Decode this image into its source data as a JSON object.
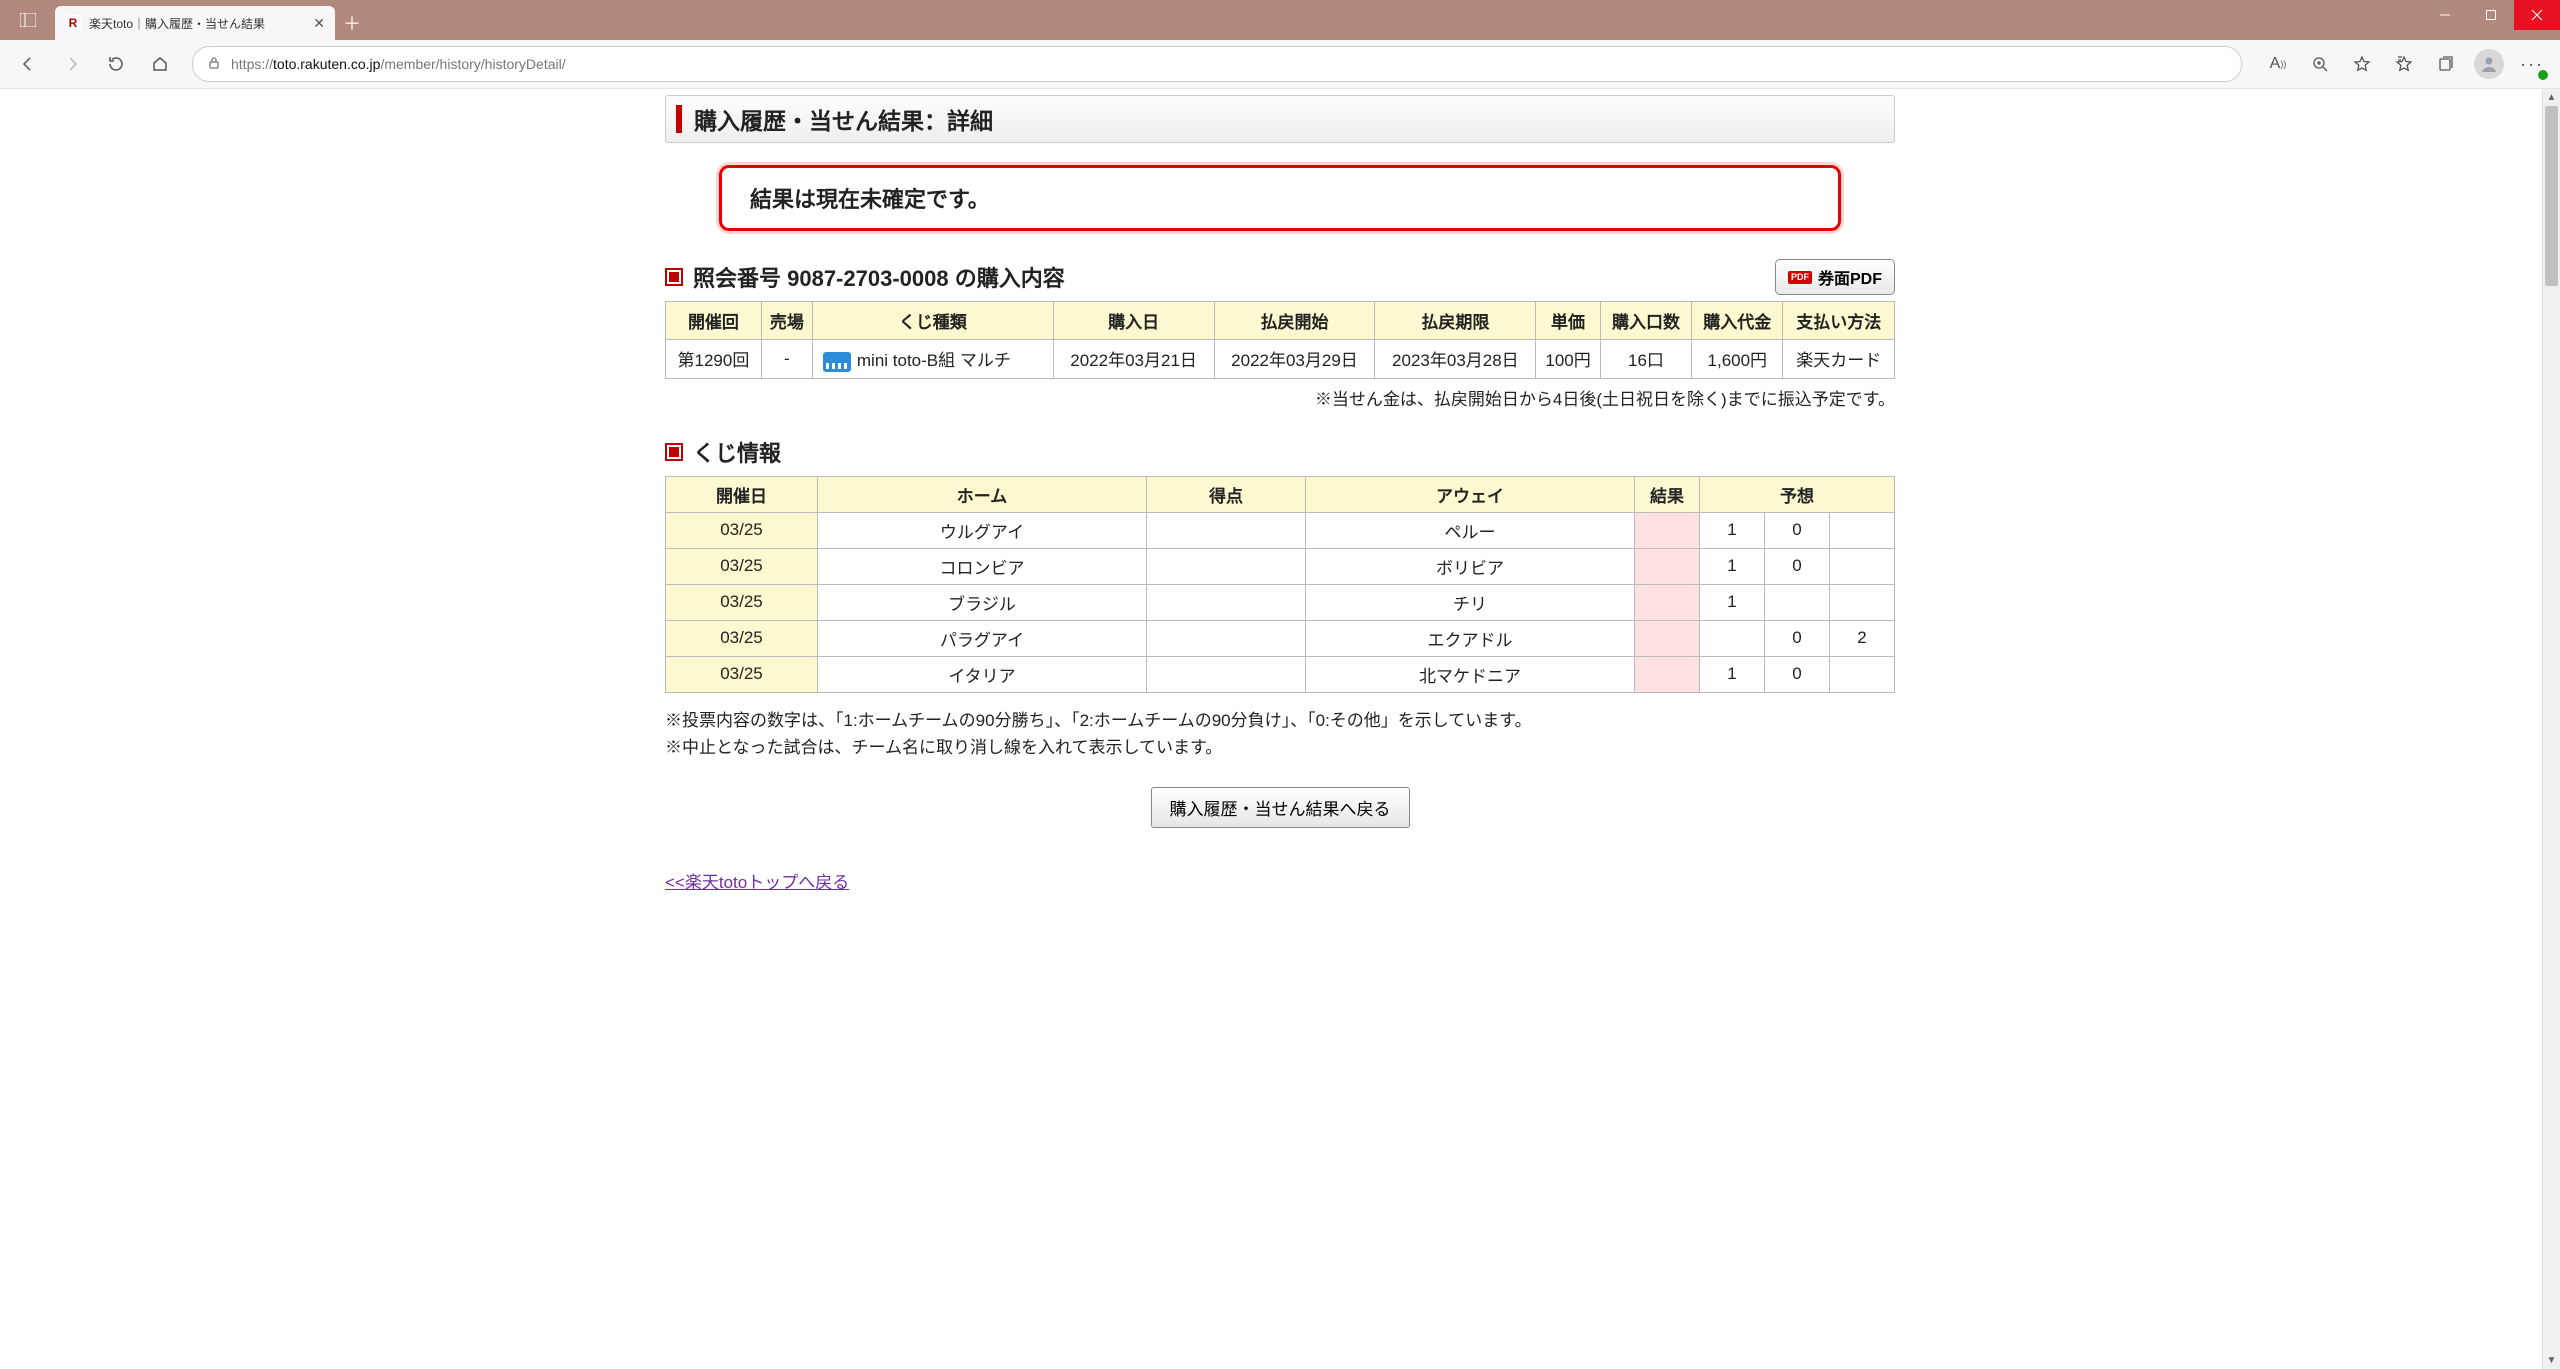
{
  "browser": {
    "tab_title": "楽天toto｜購入履歴・当せん結果",
    "url_prefix": "https://",
    "url_domain": "toto.rakuten.co.jp",
    "url_path": "/member/history/historyDetail/",
    "favicon_letter": "R"
  },
  "page": {
    "header": "購入履歴・当せん結果：詳細",
    "notice": "結果は現在未確定です。",
    "section_purchase": "照会番号 9087-2703-0008 の購入内容",
    "pdf_label": "券面PDF",
    "pdf_icon_text": "PDF",
    "purchase_headers": [
      "開催回",
      "売場",
      "くじ種類",
      "購入日",
      "払戻開始",
      "払戻期限",
      "単価",
      "購入口数",
      "購入代金",
      "支払い方法"
    ],
    "purchase_row": {
      "kaiji": "第1290回",
      "uriba": "-",
      "kuji": "mini toto-B組 マルチ",
      "buy_date": "2022年03月21日",
      "pay_start": "2022年03月29日",
      "pay_limit": "2023年03月28日",
      "unit": "100円",
      "count": "16口",
      "total": "1,600円",
      "method": "楽天カード"
    },
    "purchase_note": "※当せん金は、払戻開始日から4日後(土日祝日を除く)までに振込予定です。",
    "section_kuji": "くじ情報",
    "kuji_headers": [
      "開催日",
      "ホーム",
      "得点",
      "アウェイ",
      "結果",
      "予想"
    ],
    "kuji_rows": [
      {
        "date": "03/25",
        "home": "ウルグアイ",
        "score": "",
        "away": "ペルー",
        "result": "",
        "preds": [
          "1",
          "0",
          ""
        ]
      },
      {
        "date": "03/25",
        "home": "コロンビア",
        "score": "",
        "away": "ボリビア",
        "result": "",
        "preds": [
          "1",
          "0",
          ""
        ]
      },
      {
        "date": "03/25",
        "home": "ブラジル",
        "score": "",
        "away": "チリ",
        "result": "",
        "preds": [
          "1",
          "",
          ""
        ]
      },
      {
        "date": "03/25",
        "home": "パラグアイ",
        "score": "",
        "away": "エクアドル",
        "result": "",
        "preds": [
          "",
          "0",
          "2"
        ]
      },
      {
        "date": "03/25",
        "home": "イタリア",
        "score": "",
        "away": "北マケドニア",
        "result": "",
        "preds": [
          "1",
          "0",
          ""
        ]
      }
    ],
    "legend1": "※投票内容の数字は、「1:ホームチームの90分勝ち」、「2:ホームチームの90分負け」、「0:その他」を示しています。",
    "legend2": "※中止となった試合は、チーム名に取り消し線を入れて表示しています。",
    "back_button": "購入履歴・当せん結果へ戻る",
    "top_link": "<<楽天totoトップへ戻る"
  }
}
